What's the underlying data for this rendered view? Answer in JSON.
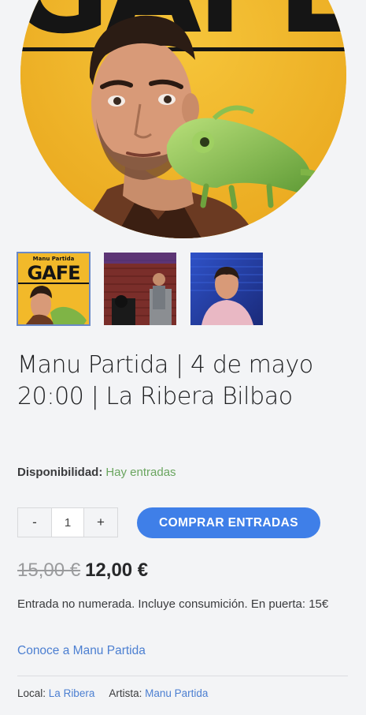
{
  "gallery": {
    "hero_alt": "GAFE poster with Manu Partida and chameleon",
    "hero_poster_text": "GAFE",
    "thumbnails": [
      {
        "poster_brand": "Manu Partida",
        "poster_title": "GAFE",
        "selected": true
      },
      {
        "poster_title": "",
        "selected": false
      },
      {
        "poster_title": "",
        "selected": false
      }
    ]
  },
  "product": {
    "title": "Manu Partida | 4 de mayo 20:00 | La Ribera Bilbao",
    "availability_label": "Disponibilidad:",
    "availability_value": "Hay entradas",
    "quantity": "1",
    "minus_label": "-",
    "plus_label": "+",
    "buy_label": "COMPRAR ENTRADAS",
    "price_old": "15,00 €",
    "price_new": "12,00 €",
    "description": "Entrada no numerada. Incluye consumición. En puerta: 15€",
    "artist_link": "Conoce a Manu Partida"
  },
  "meta": {
    "local_label": "Local:",
    "local_value": "La Ribera",
    "artist_label": "Artista:",
    "artist_value": "Manu Partida"
  },
  "colors": {
    "accent": "#3f7fe8",
    "link": "#4c7fd1",
    "in_stock": "#6aa55f",
    "poster_yellow": "#f2b92a"
  }
}
